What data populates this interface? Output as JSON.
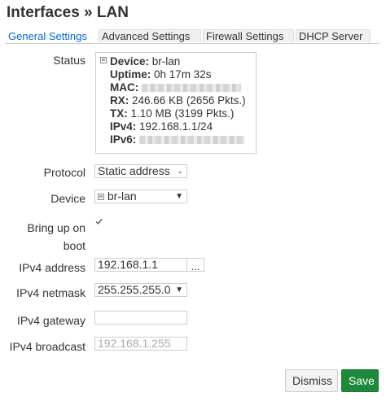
{
  "page": {
    "title": "Interfaces » LAN"
  },
  "tabs": [
    {
      "label": "General Settings",
      "active": true
    },
    {
      "label": "Advanced Settings"
    },
    {
      "label": "Firewall Settings"
    },
    {
      "label": "DHCP Server"
    }
  ],
  "status": {
    "label": "Status",
    "device_key": "Device:",
    "device_val": "br-lan",
    "uptime_key": "Uptime:",
    "uptime_val": "0h 17m 32s",
    "mac_key": "MAC:",
    "rx_key": "RX:",
    "rx_val": "246.66 KB (2656 Pkts.)",
    "tx_key": "TX:",
    "tx_val": "1.10 MB (3199 Pkts.)",
    "ipv4_key": "IPv4:",
    "ipv4_val": "192.168.1.1/24",
    "ipv6_key": "IPv6:"
  },
  "form": {
    "protocol_label": "Protocol",
    "protocol_value": "Static address",
    "device_label": "Device",
    "device_value": "br-lan",
    "bringup_label": "Bring up on boot",
    "bringup_checked": true,
    "ipv4_address_label": "IPv4 address",
    "ipv4_address_value": "192.168.1.1",
    "ipv4_address_more": "...",
    "ipv4_netmask_label": "IPv4 netmask",
    "ipv4_netmask_value": "255.255.255.0",
    "ipv4_gateway_label": "IPv4 gateway",
    "ipv4_gateway_value": "",
    "ipv4_broadcast_label": "IPv4 broadcast",
    "ipv4_broadcast_placeholder": "192.168.1.255"
  },
  "actions": {
    "dismiss_label": "Dismiss",
    "save_label": "Save"
  },
  "colors": {
    "accent": "#0069d6",
    "save": "#1d8a3b"
  }
}
